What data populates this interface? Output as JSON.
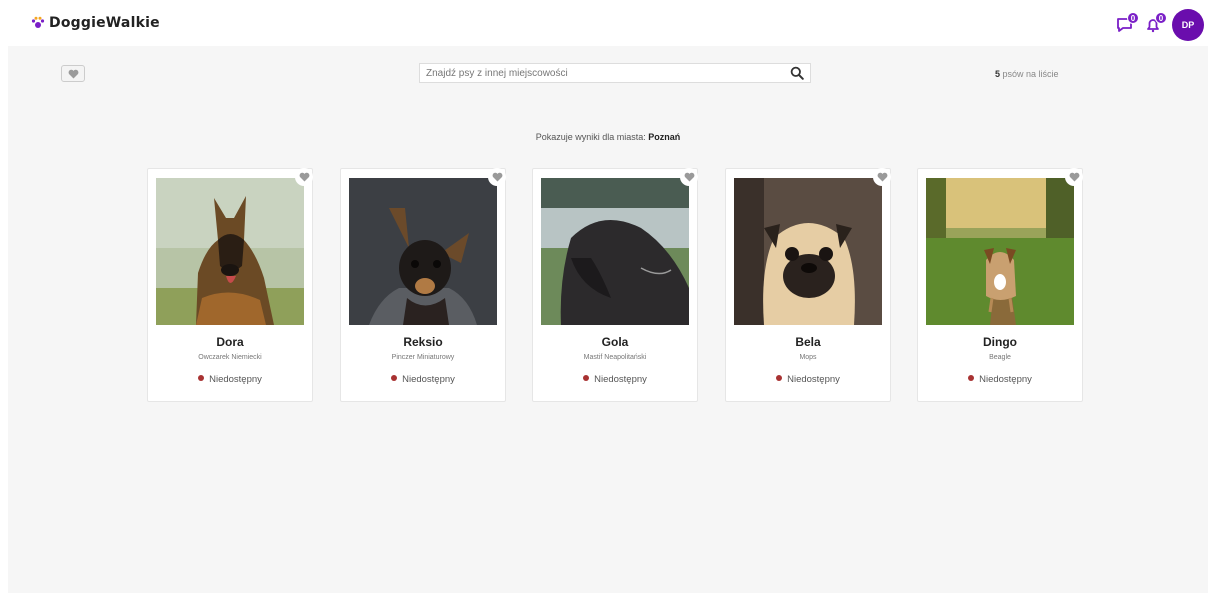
{
  "header": {
    "brand": "DoggieWalkie",
    "messages_badge": "0",
    "notifications_badge": "0",
    "avatar_initials": "DP",
    "accent_color": "#6a0dad"
  },
  "toolbar": {
    "search_placeholder": "Znajdź psy z innej miejscowości",
    "count_number": "5",
    "count_suffix": " psów na liście"
  },
  "results": {
    "prefix": "Pokazuje wyniki dla miasta: ",
    "city": "Poznań"
  },
  "dogs": [
    {
      "name": "Dora",
      "breed": "Owczarek Niemiecki",
      "status": "Niedostępny"
    },
    {
      "name": "Reksio",
      "breed": "Pinczer Miniaturowy",
      "status": "Niedostępny"
    },
    {
      "name": "Gola",
      "breed": "Mastif Neapolitański",
      "status": "Niedostępny"
    },
    {
      "name": "Bela",
      "breed": "Mops",
      "status": "Niedostępny"
    },
    {
      "name": "Dingo",
      "breed": "Beagle",
      "status": "Niedostępny"
    }
  ],
  "icons": {
    "logo": "paw-icon",
    "messages": "chat-icon",
    "notifications": "bell-icon",
    "favorites": "heart-icon",
    "search": "search-icon"
  }
}
